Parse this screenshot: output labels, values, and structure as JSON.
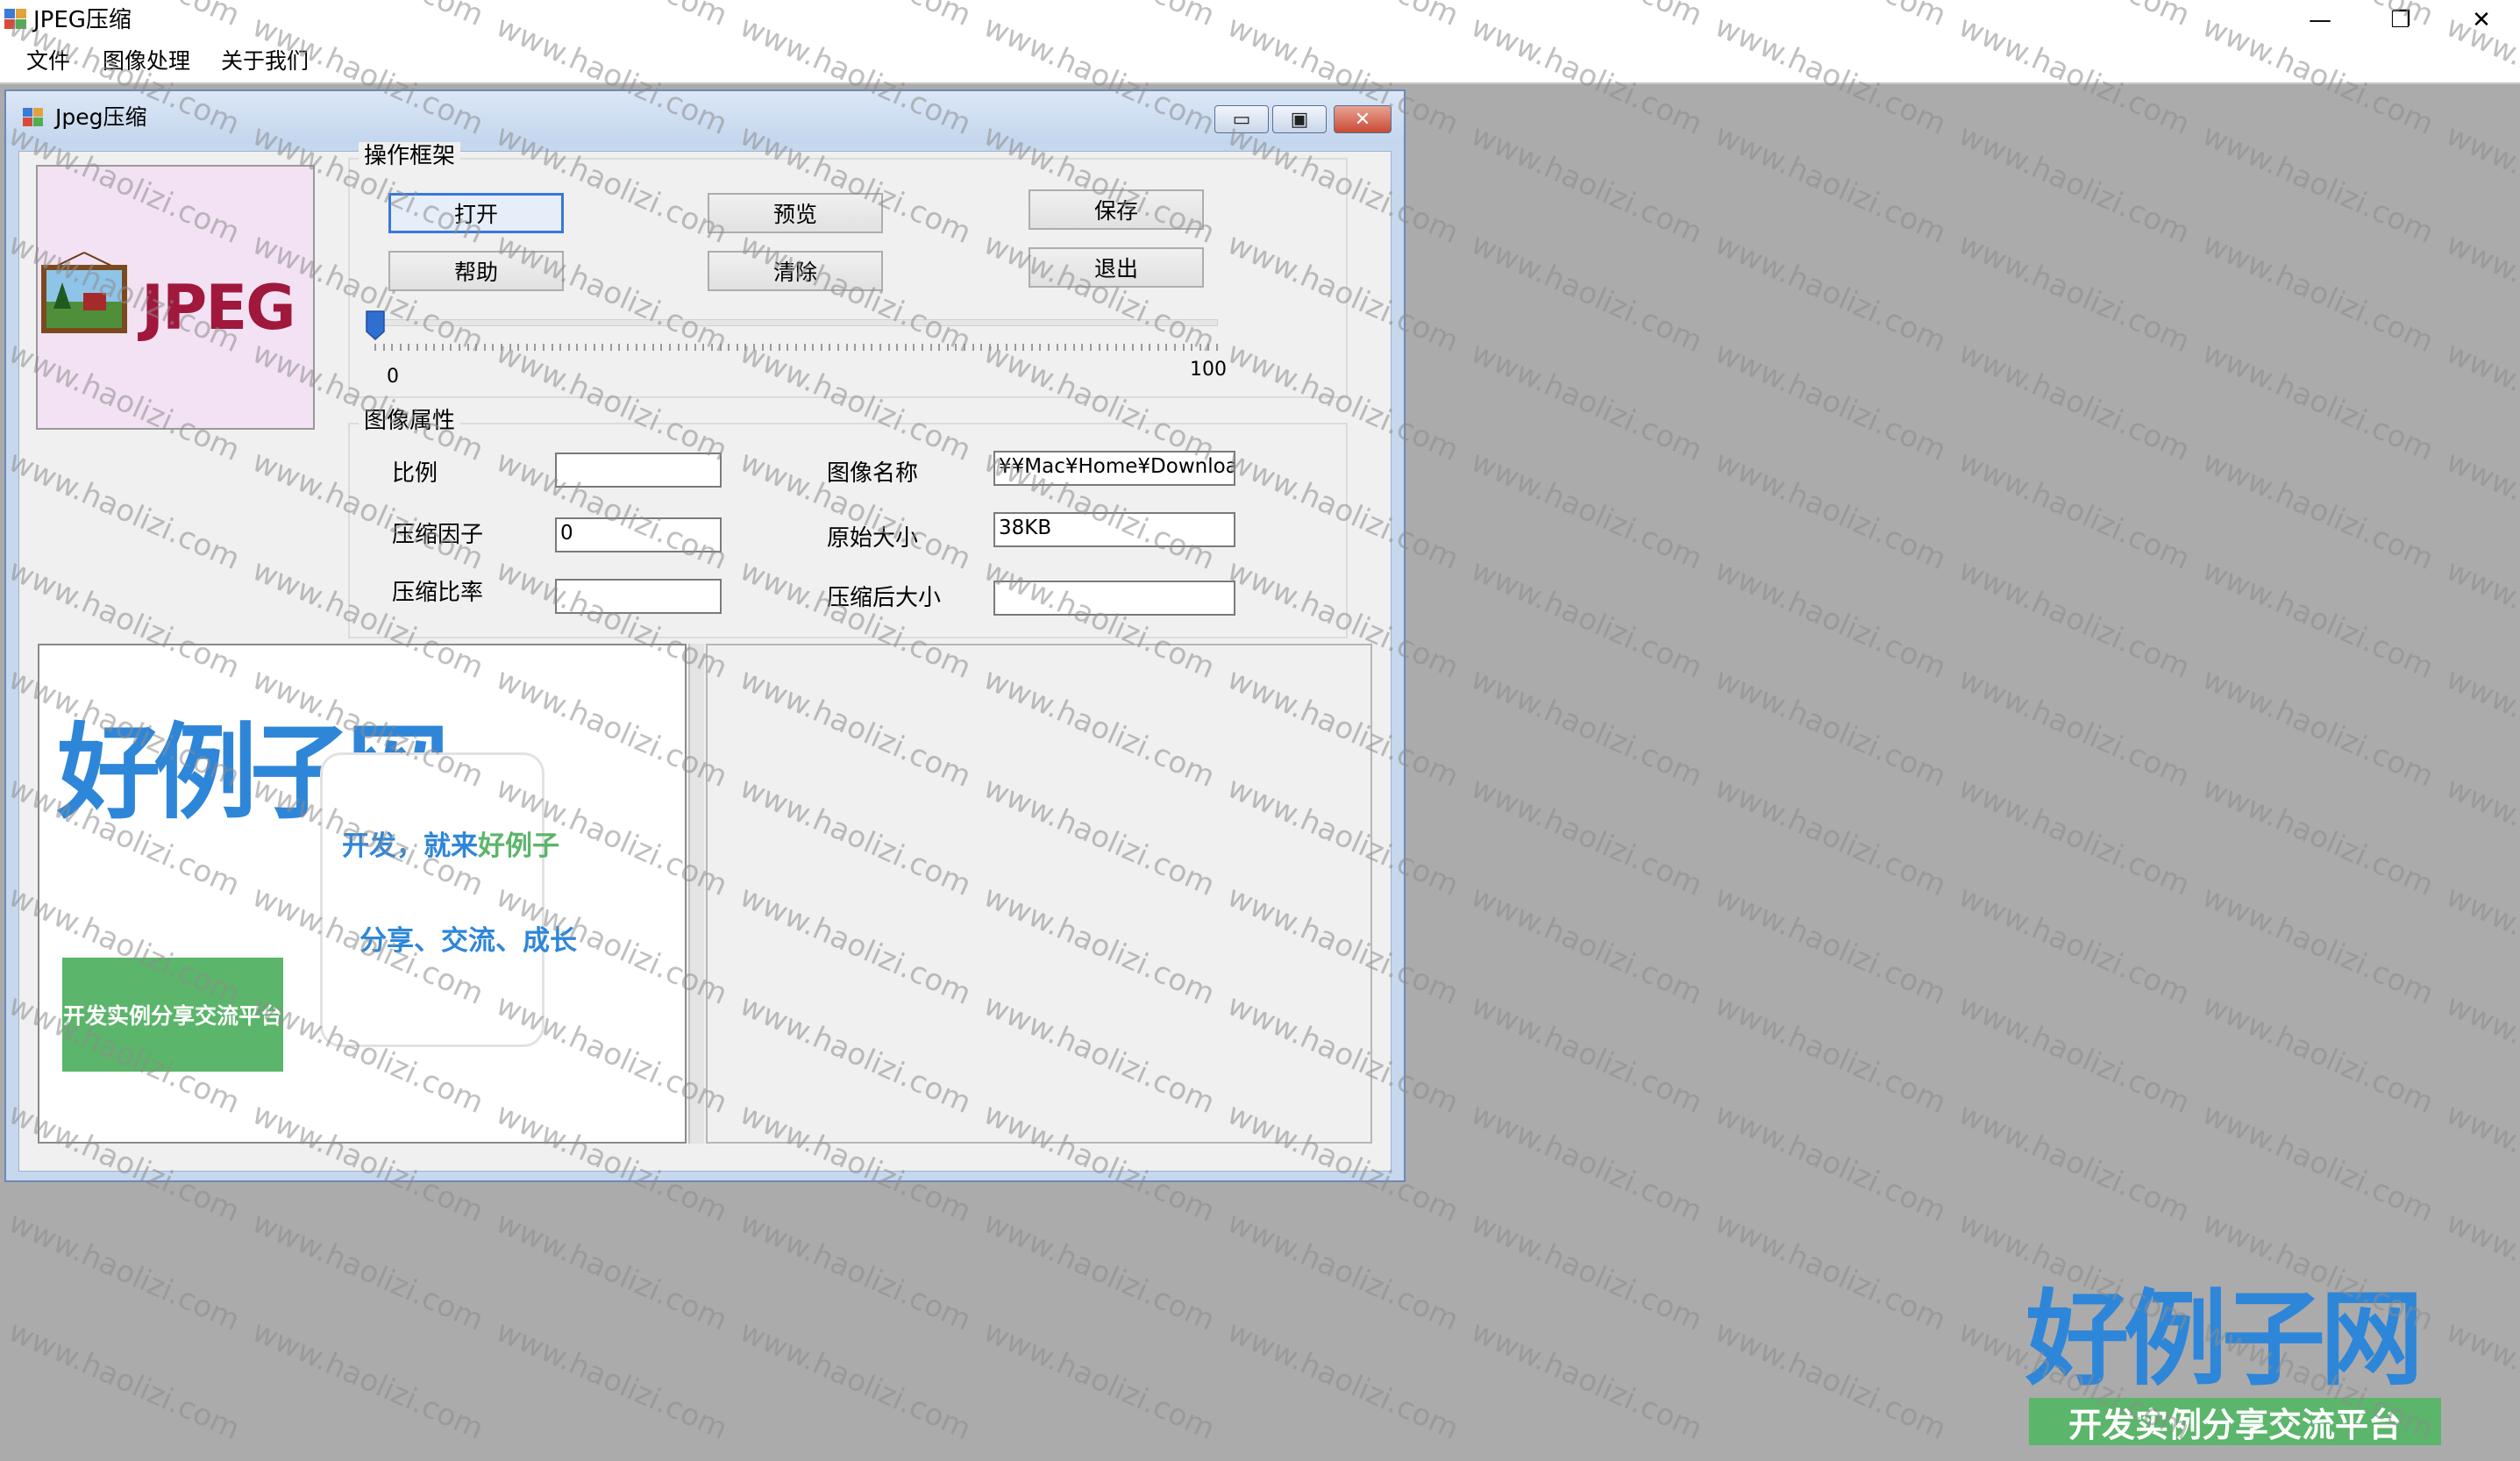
{
  "app": {
    "title": "JPEG压缩",
    "window_controls": {
      "minimize": "—",
      "restore": "❐",
      "close": "✕"
    }
  },
  "menu": [
    "文件",
    "图像处理",
    "关于我们"
  ],
  "child_window": {
    "title": "Jpeg压缩",
    "controls": {
      "minimize": "▭",
      "restore": "▣",
      "close": "✕"
    }
  },
  "logo": {
    "text": "JPEG"
  },
  "operations": {
    "group_label": "操作框架",
    "buttons": {
      "open": "打开",
      "preview": "预览",
      "save": "保存",
      "help": "帮助",
      "clear": "清除",
      "exit": "退出"
    },
    "slider": {
      "min_label": "0",
      "max_label": "100",
      "value": 0
    }
  },
  "properties": {
    "group_label": "图像属性",
    "ratio": {
      "label": "比例",
      "value": ""
    },
    "quality": {
      "label": "压缩因子",
      "value": "0"
    },
    "compression_rate": {
      "label": "压缩比率",
      "value": ""
    },
    "image_name": {
      "label": "图像名称",
      "value": "¥¥Mac¥Home¥Download"
    },
    "original_size": {
      "label": "原始大小",
      "value": "38KB"
    },
    "compressed_size": {
      "label": "压缩后大小",
      "value": ""
    }
  },
  "preview_image": {
    "title": "好例子网",
    "subtitle": "开发实例分享交流平台",
    "slogan_line1_a": "开发，就来",
    "slogan_line1_b": "好例子",
    "slogan_line2": "分享、交流、成长"
  },
  "corner_logo": {
    "title": "好例子网",
    "subtitle": "开发实例分享交流平台"
  },
  "watermark": "www.haolizi.com",
  "colors": {
    "accent_blue": "#2e86d9",
    "green": "#5bb56a",
    "jpeg_red": "#a0183c"
  }
}
